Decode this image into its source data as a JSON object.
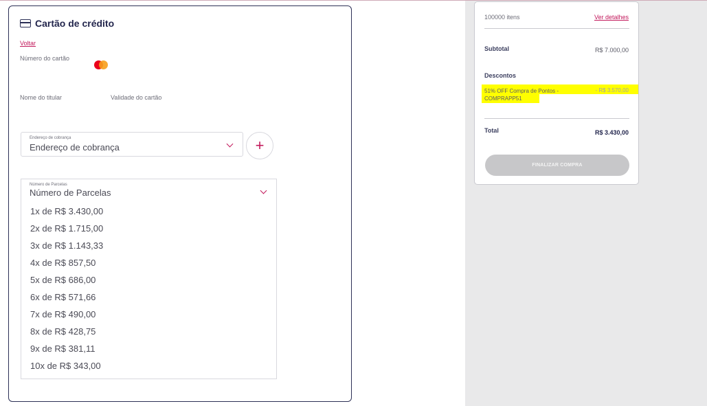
{
  "payment": {
    "title": "Cartão de crédito",
    "back_label": "Voltar",
    "card_number_label": "Número do cartão",
    "card_brand_icon": "mastercard-icon",
    "holder_name_label": "Nome do titular",
    "expiry_label": "Validade do cartão",
    "billing_address": {
      "floating_label": "Endereço de cobrança",
      "value": "Endereço de cobrança"
    },
    "add_button_label": "+",
    "installments": {
      "floating_label": "Número de Parcelas",
      "value": "Número de Parcelas",
      "options": [
        "1x de R$ 3.430,00",
        "2x de R$ 1.715,00",
        "3x de R$ 1.143,33",
        "4x de R$ 857,50",
        "5x de R$ 686,00",
        "6x de R$ 571,66",
        "7x de R$ 490,00",
        "8x de R$ 428,75",
        "9x de R$ 381,11",
        "10x de R$ 343,00"
      ]
    }
  },
  "summary": {
    "items_count": "100000 itens",
    "details_link": "Ver detalhes",
    "subtotal_label": "Subtotal",
    "subtotal_value": "R$ 7.000,00",
    "discounts_label": "Descontos",
    "discount_line_1": "51% OFF Compra de Pontos -",
    "discount_line_2": "COMPRAPP51",
    "discount_value": "- R$ 3.570,00",
    "total_label": "Total",
    "total_value": "R$ 3.430,00",
    "finish_button": "FINALIZAR COMPRA"
  },
  "colors": {
    "accent": "#c2185b",
    "brand_dark": "#23264d",
    "highlight": "#ffff00",
    "panel_bg": "#e9e9ea"
  }
}
